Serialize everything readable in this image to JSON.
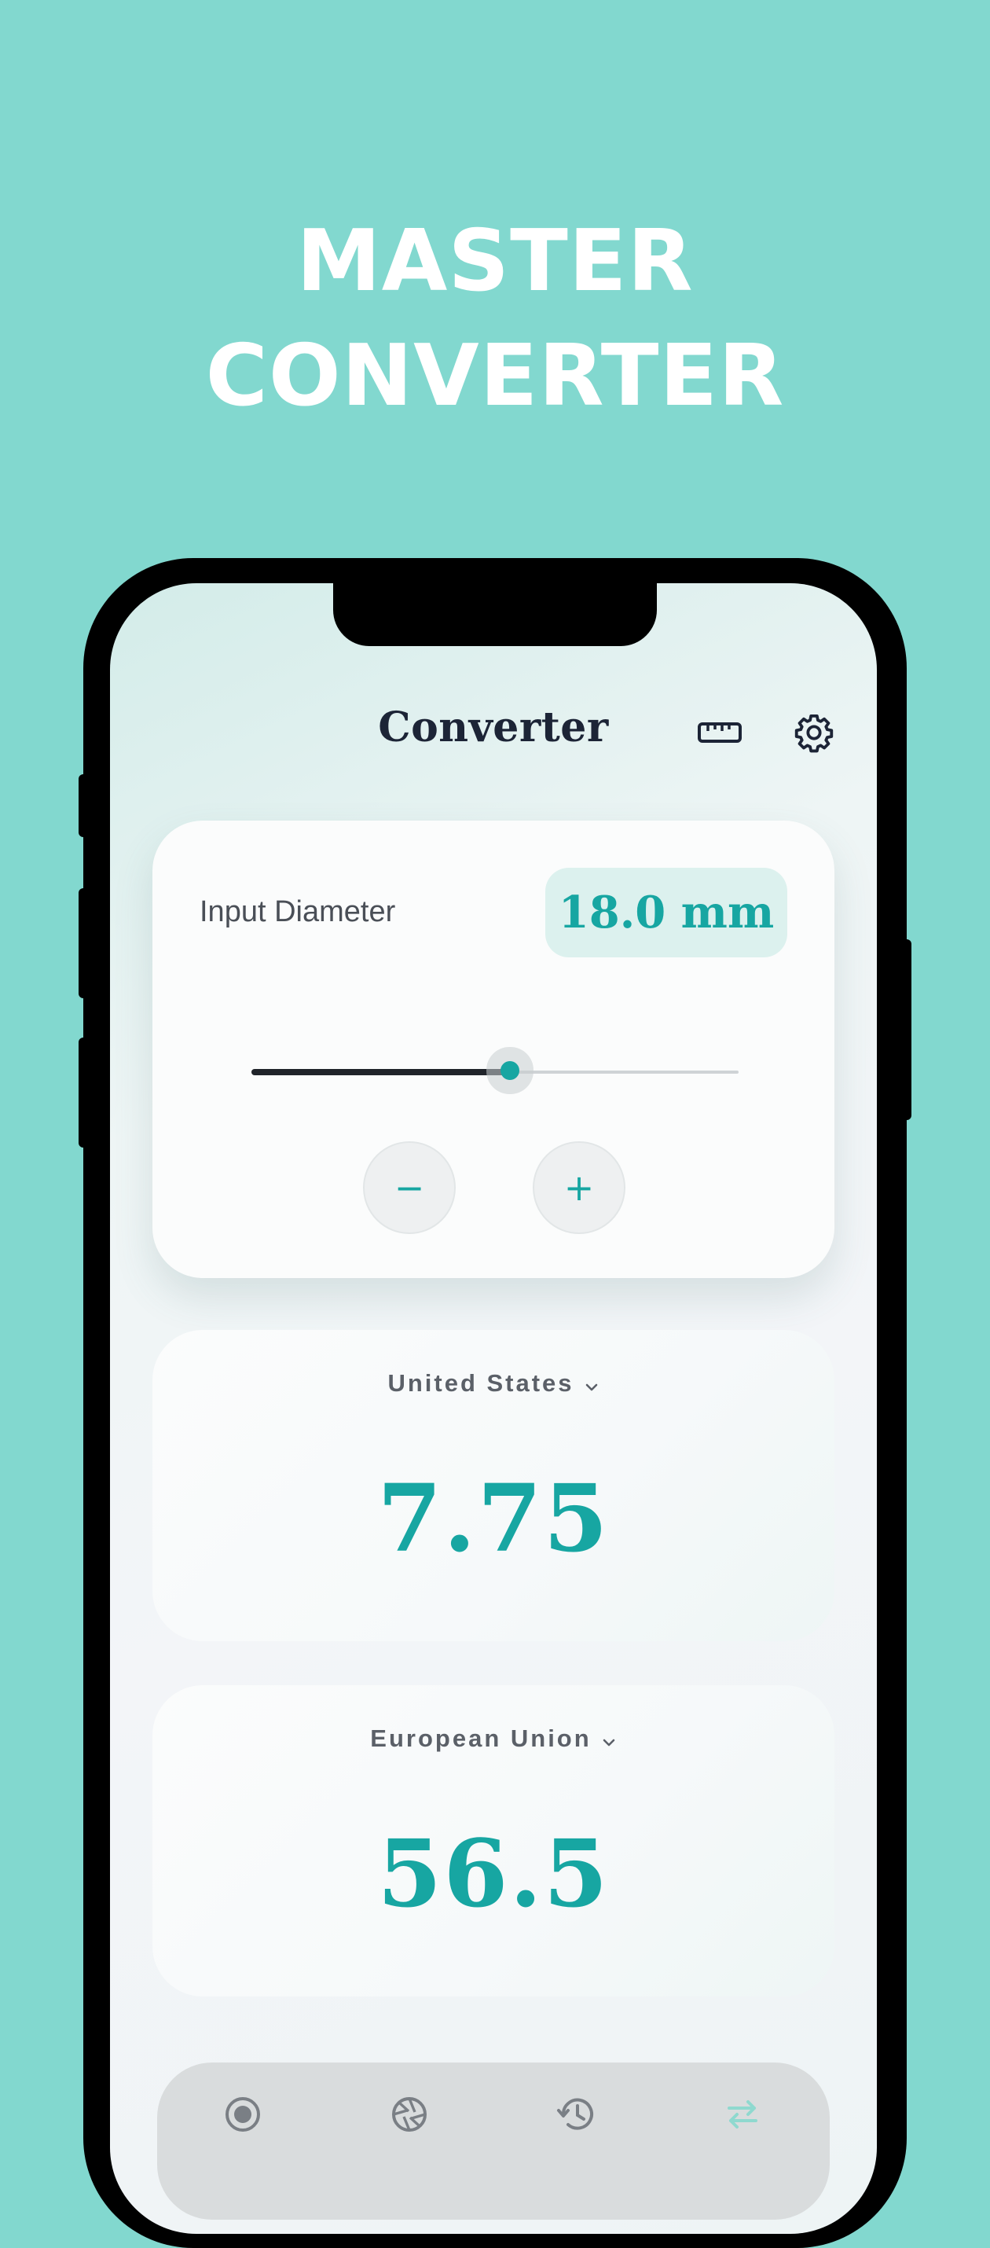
{
  "promo": {
    "headline_line1": "MASTER",
    "headline_line2": "CONVERTER"
  },
  "header": {
    "title": "Converter",
    "icons": [
      "ruler-icon",
      "gear-icon"
    ]
  },
  "input_card": {
    "label": "Input Diameter",
    "value_display": "18.0 mm",
    "slider_fraction": 0.53,
    "minus_label": "−",
    "plus_label": "+"
  },
  "results": [
    {
      "region": "United States",
      "value": "7.75"
    },
    {
      "region": "European Union",
      "value": "56.5"
    }
  ],
  "tabbar": {
    "icons": [
      "record-icon",
      "aperture-icon",
      "history-icon",
      "swap-icon"
    ],
    "active_index": 3
  },
  "colors": {
    "background": "#82d8cf",
    "accent": "#17a6a2",
    "title": "#1c2436"
  }
}
